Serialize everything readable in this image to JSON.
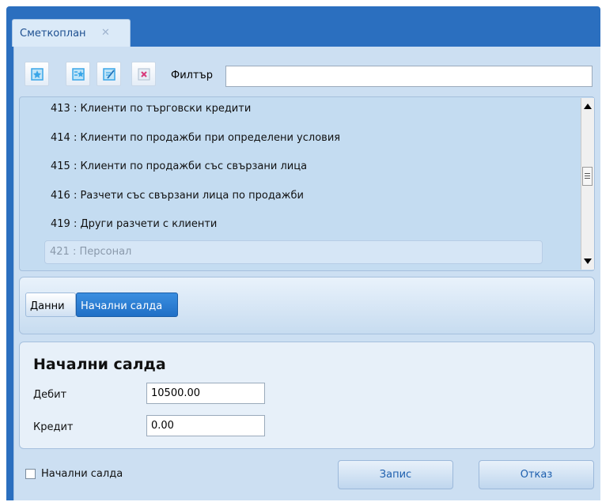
{
  "window": {
    "tab_title": "Сметкоплан",
    "tab_close": "✕"
  },
  "toolbar": {
    "buttons": [
      {
        "name": "add-icon",
        "color": "#3aa6e8"
      },
      {
        "name": "add-child-icon",
        "color": "#3aa6e8"
      },
      {
        "name": "edit-icon",
        "color": "#3aa6e8"
      },
      {
        "name": "delete-icon",
        "color": "#d83a7a"
      }
    ],
    "filter_label": "Филтър",
    "filter_value": ""
  },
  "accounts": {
    "items": [
      "413 : Клиенти по търговски кредити",
      "414 : Клиенти по продажби при определени условия",
      "415 : Клиенти по продажби със свързани лица",
      "416 : Разчети със свързани лица по продажби",
      "419 : Други разчети с клиенти"
    ],
    "selected": "421 : Персонал"
  },
  "tabs": {
    "data_label": "Данни",
    "opening_label": "Начални салда"
  },
  "form": {
    "title": "Начални салда",
    "debit_label": "Дебит",
    "debit_value": "10500.00",
    "credit_label": "Кредит",
    "credit_value": "0.00"
  },
  "footer": {
    "checkbox_label": "Начални салда",
    "checkbox_checked": false,
    "save_label": "Запис",
    "cancel_label": "Отказ"
  },
  "colors": {
    "window_blue": "#2b6fbf",
    "panel_bg": "#ccdff2",
    "active_tab": "#2a80d8",
    "button_text": "#1d5fae"
  }
}
